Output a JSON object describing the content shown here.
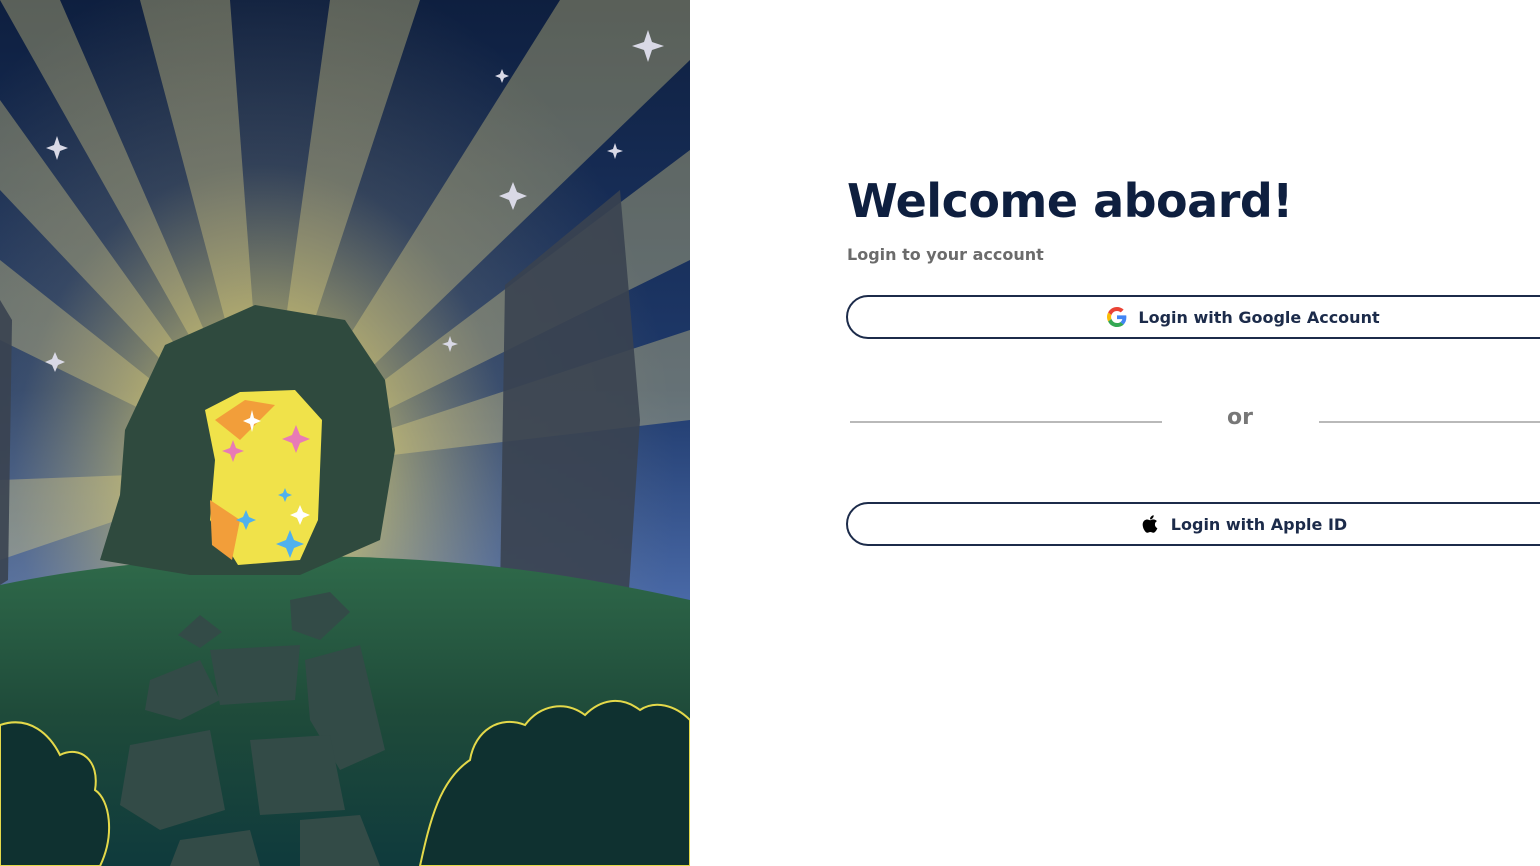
{
  "welcome": {
    "title": "Welcome aboard!",
    "subtitle": "Login to your account"
  },
  "login": {
    "google_label": "Login with Google Account",
    "divider_text": "or",
    "apple_label": "Login with Apple ID"
  },
  "icons": {
    "google": "google-icon",
    "apple": "apple-icon"
  },
  "colors": {
    "text_primary": "#0e1f3f",
    "text_secondary": "#6b6b6b",
    "button_border": "#1c2b4a",
    "divider": "#b9b9b9"
  }
}
